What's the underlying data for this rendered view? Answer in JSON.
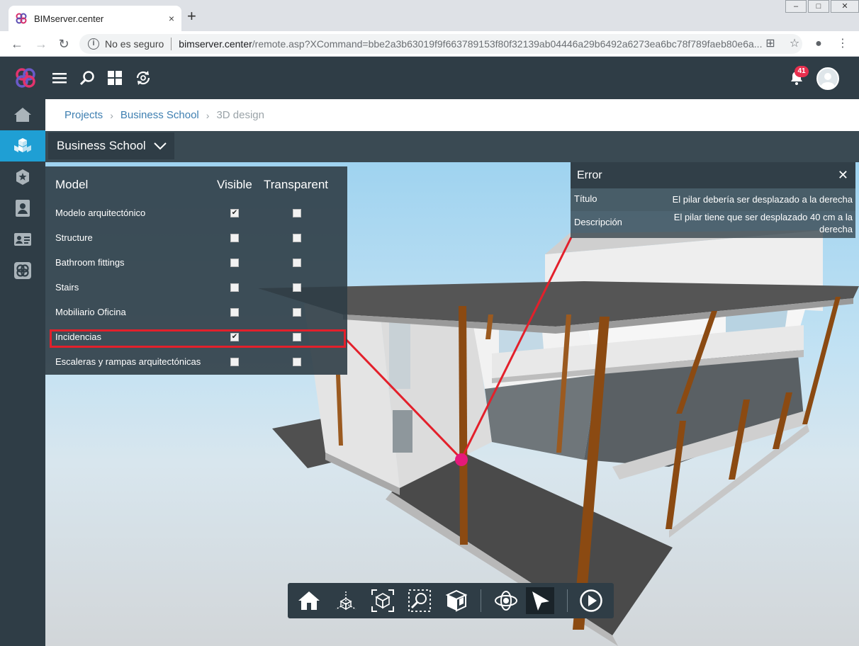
{
  "browser": {
    "tab_title": "BIMserver.center",
    "tab_close": "×",
    "new_tab": "+",
    "security_label": "No es seguro",
    "url_host": "bimserver.center",
    "url_path": "/remote.asp?XCommand=bbe2a3b63019f9f663789153f80f32139ab04446a29b6492a6273ea6bc78f789faeb80e6a..."
  },
  "header": {
    "notification_count": "41"
  },
  "breadcrumb": {
    "items": [
      "Projects",
      "Business School",
      "3D design"
    ]
  },
  "project": {
    "selector_label": "Business School"
  },
  "model_panel": {
    "col_model": "Model",
    "col_visible": "Visible",
    "col_transparent": "Transparent",
    "rows": [
      {
        "name": "Modelo arquitectónico",
        "visible": true,
        "transparent": false
      },
      {
        "name": "Structure",
        "visible": false,
        "transparent": false
      },
      {
        "name": "Bathroom fittings",
        "visible": false,
        "transparent": false
      },
      {
        "name": "Stairs",
        "visible": false,
        "transparent": false
      },
      {
        "name": "Mobiliario Oficina",
        "visible": false,
        "transparent": false
      },
      {
        "name": "Incidencias",
        "visible": true,
        "transparent": false
      },
      {
        "name": "Escaleras y rampas arquitectónicas",
        "visible": false,
        "transparent": false
      }
    ],
    "highlighted_row": "Incidencias"
  },
  "error_panel": {
    "title": "Error",
    "close": "✕",
    "fields": [
      {
        "label": "Título",
        "value": "El pilar debería ser desplazado a la derecha"
      },
      {
        "label": "Descripción",
        "value": "El pilar tiene que ser desplazado 40 cm a la derecha"
      }
    ]
  },
  "toolbar": {
    "buttons": [
      "home-view",
      "axes",
      "fit-box",
      "zoom-window",
      "section-box",
      "orbit",
      "select-pointer",
      "play"
    ],
    "active": "select-pointer"
  },
  "colors": {
    "header_bg": "#2f3d46",
    "accent": "#1f9fd4",
    "highlight_red": "#e3202b",
    "badge": "#e8304f",
    "pillar": "#8b4a12",
    "marker": "#e5197a"
  }
}
